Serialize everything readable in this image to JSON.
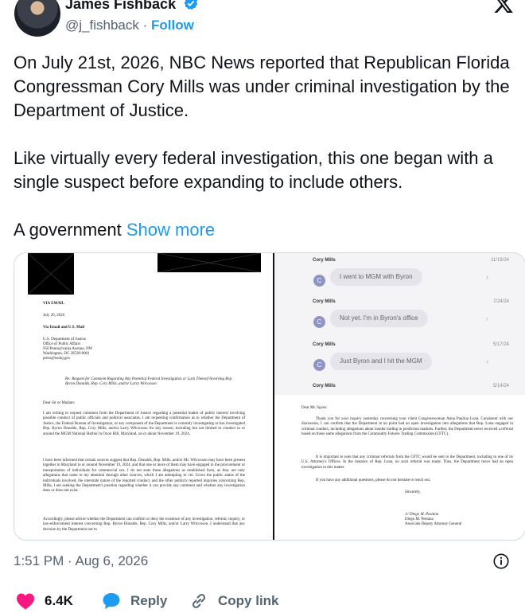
{
  "author": {
    "name": "James Fishback",
    "handle": "@j_fishback",
    "separator": "·",
    "follow_label": "Follow"
  },
  "tweet": {
    "paragraphs": [
      "On July 21st, 2026, NBC News reported that Republican Florida Congressman Cory Mills was under criminal investigation by the Department of Justice.",
      "Like virtually every federal investigation, this one began with a single suspect before expanding to include others.",
      "A government"
    ],
    "show_more": "Show more"
  },
  "media": {
    "letter_left": {
      "via": "VIA EMAIL",
      "date": "July 20, 2026",
      "via2": "Via Email and U.S. Mail",
      "address": [
        "U.S. Department of Justice",
        "Office of Public Affairs",
        "950 Pennsylvania Avenue, NW",
        "Washington, DC 20530-0001",
        "press@usdoj.gov"
      ],
      "re": "Re: Request for Comment Regarding Any Potential Federal Investigation or Lack Thereof Involving Rep. Byron Donalds, Rep. Cory Mills, and/or Larry Wilcoxson",
      "salutation": "Dear Sir or Madam:",
      "body1": "I am writing to request comment from the Department of Justice regarding a potential matter of public interest involving possible conduct of public officials and political associates. I am requesting confirmation as to whether the Department of Justice, the Federal Bureau of Investigation, or any component of the Department is currently investigating or has investigated Rep. Byron Donalds, Rep. Cory Mills, and/or Larry Wilcoxson for any reason, including but not limited to conduct in or around the MGM National Harbor in Oxon Hill, Maryland, on or about November 19, 2024.",
      "body2": "I have been informed that certain sources suggest that Rep. Donalds, Rep. Mills, and/or Mr. Wilcoxson may have been present together in Maryland in or around November 19, 2024, and that one or more of them may have engaged in the procurement or transportation of individuals for commercial sex. I do not state these allegations as established facts, as they are only allegations that came to my attention through other sources, which I am attempting to vet. Given the public status of the individuals involved, the interstate nature of the reported conduct, and the other publicly reported inquiries concerning Rep. Mills, I am seeking the Department's position regarding whether it can provide any comment and whether any investigation does or does not exist.",
      "body3": "Accordingly, please advise whether the Department can confirm or deny the existence of any investigation, referral, inquiry, or law-enforcement interest concerning Rep. Byron Donalds, Rep. Cory Mills, and/or Larry Wilcoxson. I understand that any decision by the Department not to"
    },
    "messages": [
      {
        "sender": "Cory Mills",
        "date": "11/19/24",
        "text": "I went to MGM with Byron",
        "avatar": "C"
      },
      {
        "sender": "Cory Mills",
        "date": "7/24/24",
        "text": "Not yet. I'm in Byron's office",
        "avatar": "C"
      },
      {
        "sender": "Cory Mills",
        "date": "5/17/24",
        "text": "Just Byron and I hit the MGM",
        "avatar": "C"
      },
      {
        "sender": "Cory Mills",
        "date": "5/14/24",
        "text": "",
        "avatar": "C"
      }
    ],
    "letter_right": {
      "salutation": "Dear Mr. Spyes:",
      "body1": "Thank you for your inquiry yesterday concerning your client Congresswoman Anna Paulina Luna. Consistent with our discussion, I can confirm that the Department at no point had an open investigation into allegations that Rep. Luna engaged in criminal conduct, including allegations about insider trading in prediction markets. Further, the Department never received a referral based on those same allegations from the Commodity Futures Trading Commission (CFTC).",
      "body2": "It is important to note that any criminal referrals from the CFTC would be sent to the Department, including to one of its U.S. Attorney's Offices. In the instance of Rep. Luna, no such referral was made. Thus, the Department never had an open investigation in this matter.",
      "body3": "If you have any additional questions, please do not hesitate to reach out.",
      "closing": "Sincerely,",
      "sig": "/s/ Diego M. Pestana",
      "signer": "Diego M. Pestana",
      "title": "Associate Deputy Attorney General"
    }
  },
  "meta": {
    "timestamp": "1:51 PM · Aug 6, 2026"
  },
  "actions": {
    "likes": "6.4K",
    "reply": "Reply",
    "copy": "Copy link"
  },
  "colors": {
    "accent": "#1d9bf0",
    "like": "#f91880",
    "muted": "#536471"
  }
}
